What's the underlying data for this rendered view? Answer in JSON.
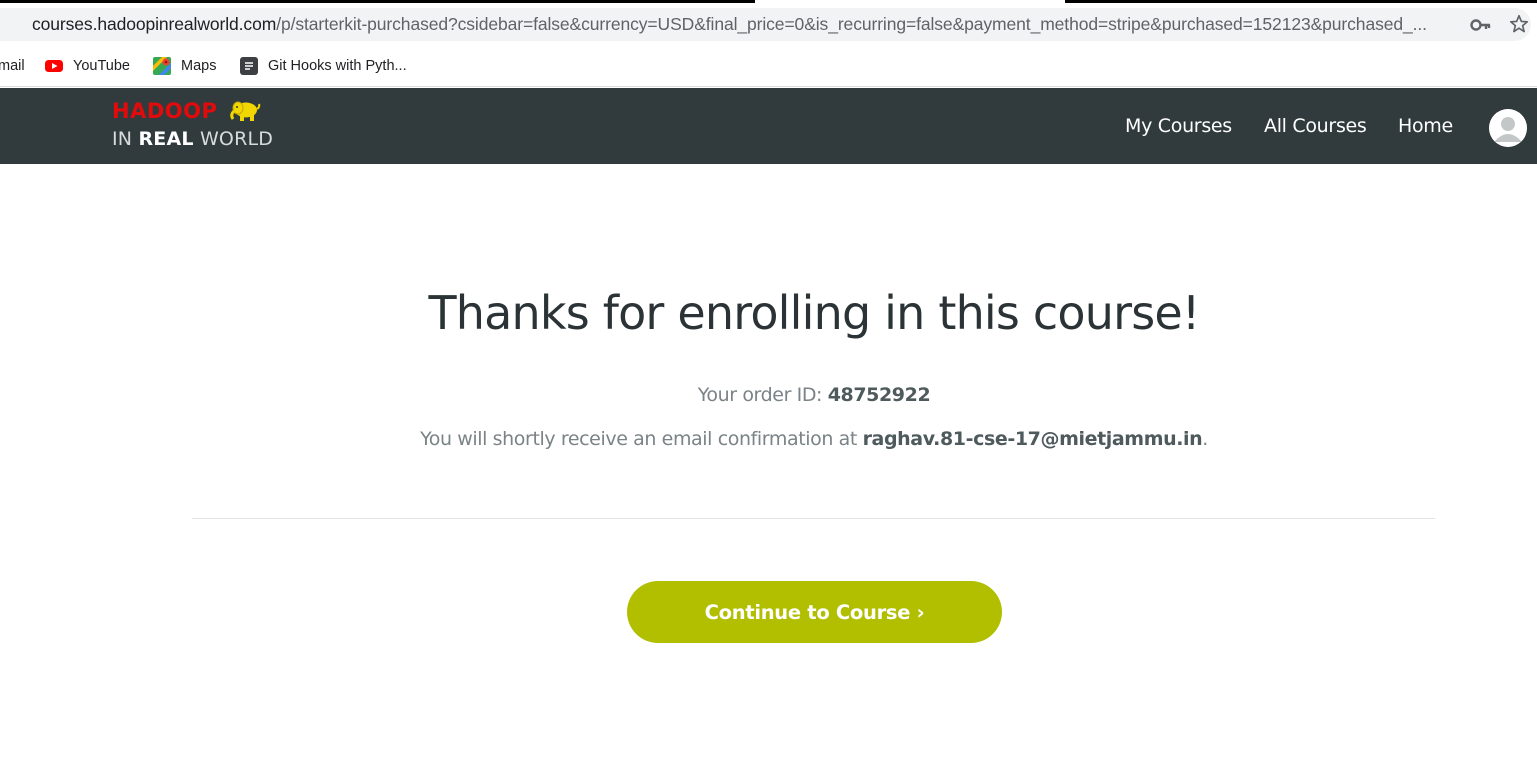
{
  "browser": {
    "url_host": "courses.hadoopinrealworld.com",
    "url_path": "/p/starterkit-purchased?csidebar=false&currency=USD&final_price=0&is_recurring=false&payment_method=stripe&purchased=152123&purchased_...",
    "bookmarks": [
      {
        "label": "mail",
        "icon": "gmail-icon"
      },
      {
        "label": "YouTube",
        "icon": "youtube-icon"
      },
      {
        "label": "Maps",
        "icon": "maps-icon"
      },
      {
        "label": "Git Hooks with Pyth...",
        "icon": "page-icon"
      }
    ]
  },
  "site": {
    "logo_top": "HADOOP",
    "logo_bottom_prefix": "IN ",
    "logo_bottom_bold": "REAL",
    "logo_bottom_suffix": " WORLD",
    "nav": {
      "my_courses": "My Courses",
      "all_courses": "All Courses",
      "home": "Home"
    }
  },
  "confirmation": {
    "headline": "Thanks for enrolling in this course!",
    "order_label": "Your order ID: ",
    "order_id": "48752922",
    "email_prefix": "You will shortly receive an email confirmation at ",
    "email": "raghav.81-cse-17@mietjammu.in",
    "email_suffix": ".",
    "continue_label": "Continue to Course ›"
  },
  "colors": {
    "header_bg": "#313b3d",
    "accent_button": "#b1bf00",
    "logo_red": "#e20b0b",
    "logo_yellow": "#f2d600"
  }
}
